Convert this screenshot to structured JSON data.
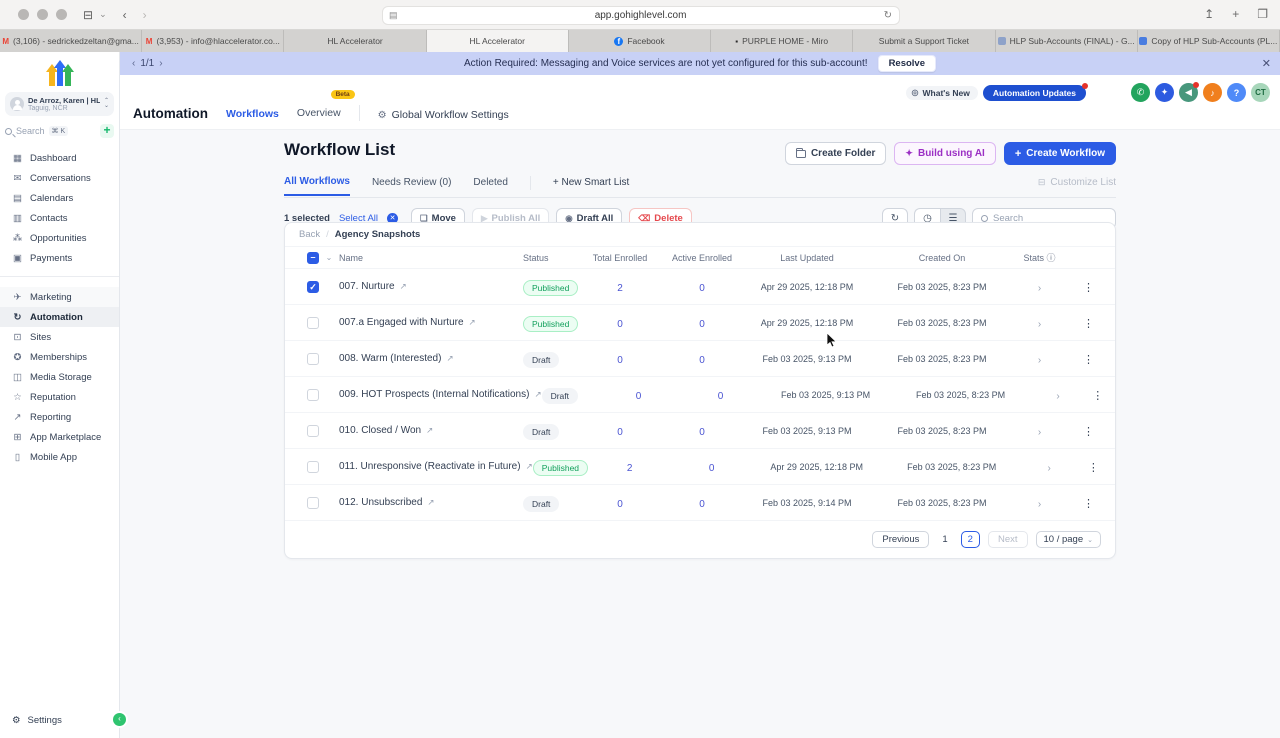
{
  "browser": {
    "url": "app.gohighlevel.com",
    "tabs": [
      {
        "label": "(3,106) - sedrickedzeltan@gma...",
        "icon": "M"
      },
      {
        "label": "(3,953) - info@hlaccelerator.co...",
        "icon": "M"
      },
      {
        "label": "HL Accelerator",
        "icon": ""
      },
      {
        "label": "HL Accelerator",
        "icon": ""
      },
      {
        "label": "Facebook",
        "icon": "f"
      },
      {
        "label": "PURPLE HOME - Miro",
        "icon": "▪"
      },
      {
        "label": "Submit a Support Ticket",
        "icon": ""
      },
      {
        "label": "HLP Sub-Accounts (FINAL) - G...",
        "icon": ""
      },
      {
        "label": "Copy of HLP Sub-Accounts (PL...",
        "icon": ""
      }
    ]
  },
  "banner": {
    "pager": "1/1",
    "prev": "‹",
    "next": "›",
    "message": "Action Required: Messaging and Voice services are not yet configured for this sub-account!",
    "resolve_label": "Resolve",
    "close": "✕"
  },
  "sidebar": {
    "account": {
      "name": "De Arroz, Karen | HL...",
      "location": "Taguig, NCR",
      "chevron_up": "⌃",
      "chevron_down": "⌄"
    },
    "search": {
      "placeholder": "Search",
      "shortcut": "⌘ K",
      "add": "+"
    },
    "nav_primary": [
      {
        "label": "Dashboard",
        "icon": "▦"
      },
      {
        "label": "Conversations",
        "icon": "✉"
      },
      {
        "label": "Calendars",
        "icon": "▤"
      },
      {
        "label": "Contacts",
        "icon": "▥"
      },
      {
        "label": "Opportunities",
        "icon": "⁂"
      },
      {
        "label": "Payments",
        "icon": "▣"
      }
    ],
    "nav_secondary": [
      {
        "label": "Marketing",
        "icon": "✈"
      },
      {
        "label": "Automation",
        "icon": "↻"
      },
      {
        "label": "Sites",
        "icon": "⊡"
      },
      {
        "label": "Memberships",
        "icon": "✪"
      },
      {
        "label": "Media Storage",
        "icon": "◫"
      },
      {
        "label": "Reputation",
        "icon": "☆"
      },
      {
        "label": "Reporting",
        "icon": "↗"
      },
      {
        "label": "App Marketplace",
        "icon": "⊞"
      },
      {
        "label": "Mobile App",
        "icon": "▯"
      }
    ],
    "settings_label": "Settings",
    "settings_icon": "⚙",
    "collapse": "‹"
  },
  "header": {
    "title": "Automation",
    "tab_workflows": "Workflows",
    "tab_overview": "Overview",
    "beta": "Beta",
    "global_settings": "Global Workflow Settings",
    "gear": "⚙",
    "whats_new": "What's New",
    "whats_new_icon": "◎",
    "automation_updates": "Automation Updates",
    "phone_glyph": "✆",
    "capsule_glyph": "✦",
    "mega_glyph": "◀",
    "bell_glyph": "♪",
    "help_glyph": "?",
    "avatar_initials": "CT"
  },
  "page": {
    "title": "Workflow List",
    "create_folder": "Create Folder",
    "build_ai": "Build using AI",
    "build_ai_icon": "✦",
    "create_workflow": "Create Workflow",
    "plus": "+"
  },
  "list_tabs": {
    "all": "All Workflows",
    "needs_review": "Needs Review (0)",
    "deleted": "Deleted",
    "new_smart_list": "+  New Smart List",
    "customize": "Customize List",
    "customize_icon": "⊟"
  },
  "actions": {
    "selected": "1 selected",
    "select_all": "Select All",
    "x": "✕",
    "move": "Move",
    "move_icon": "❏",
    "publish_all": "Publish All",
    "publish_icon": "▶",
    "draft_all": "Draft All",
    "draft_icon": "◉",
    "delete": "Delete",
    "delete_icon": "⌫",
    "history_icon": "↻",
    "clock_icon": "◷",
    "list_icon": "☰",
    "search_placeholder": "Search"
  },
  "table": {
    "breadcrumb": {
      "back": "Back",
      "slash": "/",
      "current": "Agency Snapshots"
    },
    "columns": {
      "name": "Name",
      "status": "Status",
      "total": "Total Enrolled",
      "active": "Active Enrolled",
      "updated": "Last Updated",
      "created": "Created On",
      "stats": "Stats",
      "info": "ⓘ",
      "chevron": "⌄"
    },
    "rows": [
      {
        "name": "007. Nurture",
        "status": "Published",
        "total": "2",
        "active": "0",
        "updated": "Apr 29 2025, 12:18 PM",
        "created": "Feb 03 2025, 8:23 PM"
      },
      {
        "name": "007.a Engaged with Nurture",
        "status": "Published",
        "total": "0",
        "active": "0",
        "updated": "Apr 29 2025, 12:18 PM",
        "created": "Feb 03 2025, 8:23 PM"
      },
      {
        "name": "008. Warm (Interested)",
        "status": "Draft",
        "total": "0",
        "active": "0",
        "updated": "Feb 03 2025, 9:13 PM",
        "created": "Feb 03 2025, 8:23 PM"
      },
      {
        "name": "009. HOT Prospects (Internal Notifications)",
        "status": "Draft",
        "total": "0",
        "active": "0",
        "updated": "Feb 03 2025, 9:13 PM",
        "created": "Feb 03 2025, 8:23 PM"
      },
      {
        "name": "010. Closed / Won",
        "status": "Draft",
        "total": "0",
        "active": "0",
        "updated": "Feb 03 2025, 9:13 PM",
        "created": "Feb 03 2025, 8:23 PM"
      },
      {
        "name": "011. Unresponsive (Reactivate in Future)",
        "status": "Published",
        "total": "2",
        "active": "0",
        "updated": "Apr 29 2025, 12:18 PM",
        "created": "Feb 03 2025, 8:23 PM"
      },
      {
        "name": "012. Unsubscribed",
        "status": "Draft",
        "total": "0",
        "active": "0",
        "updated": "Feb 03 2025, 9:14 PM",
        "created": "Feb 03 2025, 8:23 PM"
      }
    ],
    "ext_link": "↗",
    "row_chevron": "›",
    "kebab": "⋮",
    "check": "✓",
    "indeterminate": "–"
  },
  "pagination": {
    "previous": "Previous",
    "page1": "1",
    "page2": "2",
    "next": "Next",
    "page_size": "10 / page",
    "caret": "⌄"
  },
  "colors": {
    "accent": "#2c5ce5",
    "published_green": "#12a05c",
    "banner_bg": "#c8d1f6",
    "danger": "#e5484d",
    "beta_yellow": "#fac515"
  }
}
